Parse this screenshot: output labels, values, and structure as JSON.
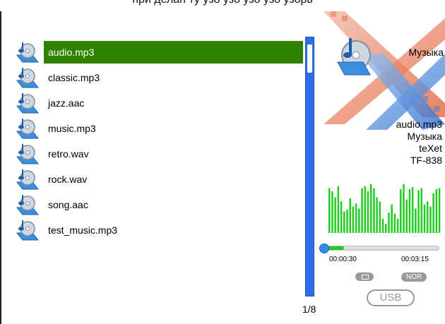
{
  "top_text": "при делан ту узо узо узо узо узорь",
  "files": [
    {
      "name": "audio.mp3",
      "selected": true
    },
    {
      "name": "classic.mp3",
      "selected": false
    },
    {
      "name": "jazz.aac",
      "selected": false
    },
    {
      "name": "music.mp3",
      "selected": false
    },
    {
      "name": "retro.wav",
      "selected": false
    },
    {
      "name": "rock.wav",
      "selected": false
    },
    {
      "name": "song.aac",
      "selected": false
    },
    {
      "name": "test_music.mp3",
      "selected": false
    }
  ],
  "page_counter": "1/8",
  "panel": {
    "album_title": "Музыка",
    "track_info": [
      "audio.mp3",
      "Музыка",
      "teXet",
      "TF-838"
    ]
  },
  "player": {
    "time_current": "00:00:30",
    "time_total": "00:03:15",
    "progress_fraction": 0.16,
    "mode_label": "NOR",
    "usb_label": "USB"
  },
  "equalizer_levels": [
    0.88,
    0.82,
    0.7,
    0.92,
    0.62,
    0.42,
    0.46,
    0.68,
    0.52,
    0.58,
    0.48,
    0.88,
    0.92,
    0.82,
    0.96,
    0.88,
    0.7,
    0.62,
    0.28,
    0.18,
    0.4,
    0.56,
    0.38,
    0.28,
    0.86,
    0.96,
    0.66,
    0.86,
    0.9,
    0.48,
    0.84,
    0.88,
    0.56,
    0.62,
    0.52,
    0.78,
    0.86,
    0.88
  ],
  "colors": {
    "selected_row": "#2e8200",
    "scrollbar": "#2f6fe6",
    "equalizer": "#22cc22",
    "progress": "#22cc22"
  },
  "icons": [
    "music-file-icon",
    "album-art-icon",
    "play-icon",
    "repeat-icon"
  ]
}
